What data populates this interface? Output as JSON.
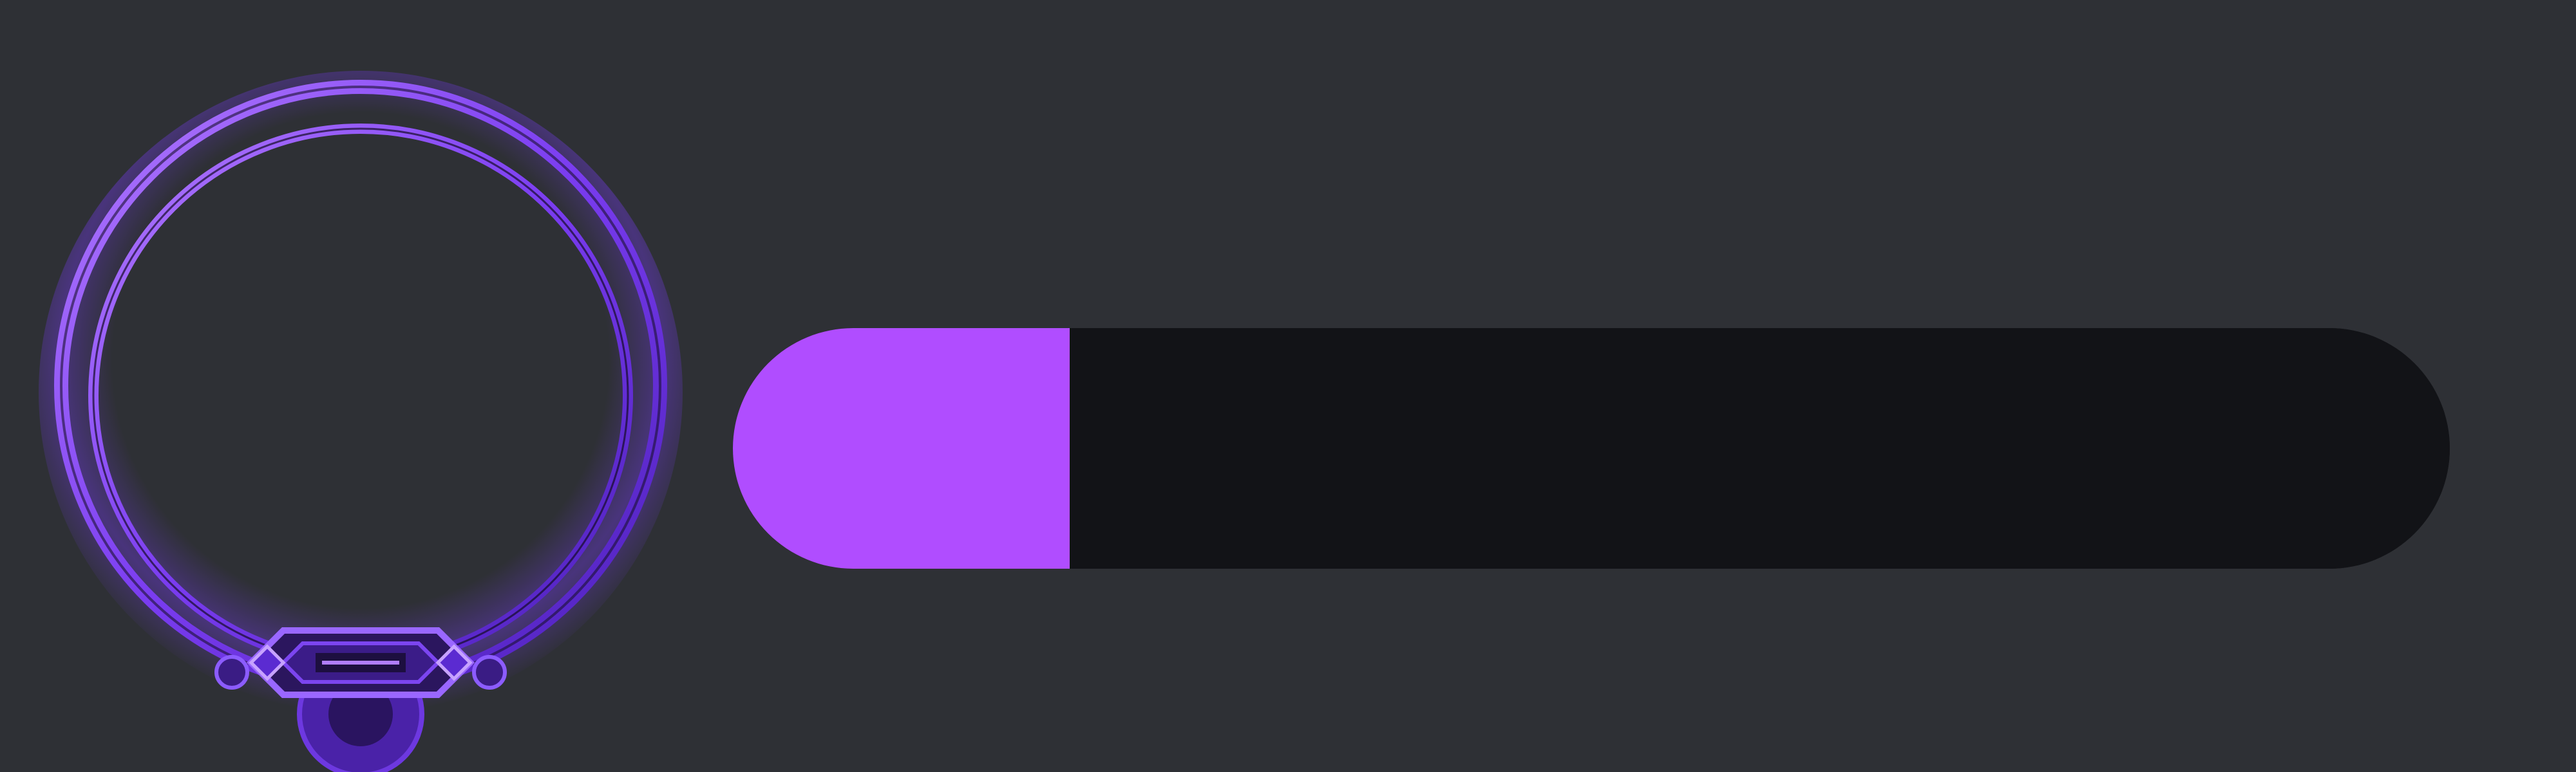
{
  "avatar": {
    "icon": "ornate-ring-frame",
    "accent_color": "#8a4dff",
    "gem_color": "#5b2bd1"
  },
  "progress": {
    "value_fraction": 0.196,
    "fill_color": "#b04dff",
    "track_color": "#121317"
  },
  "background_color": "#2e3035"
}
